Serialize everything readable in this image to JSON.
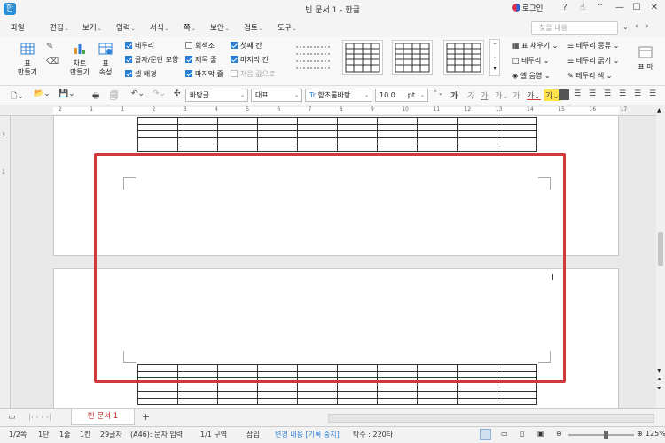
{
  "app": {
    "icon_letter": "한",
    "title": "빈 문서 1 - 한글",
    "login": "로그인"
  },
  "menu": [
    {
      "label": "파일",
      "dropdown": false
    },
    {
      "label": "편집",
      "dropdown": true
    },
    {
      "label": "보기",
      "dropdown": true
    },
    {
      "label": "입력",
      "dropdown": true
    },
    {
      "label": "서식",
      "dropdown": true
    },
    {
      "label": "쪽",
      "dropdown": true
    },
    {
      "label": "보안",
      "dropdown": true
    },
    {
      "label": "검토",
      "dropdown": true
    },
    {
      "label": "도구",
      "dropdown": true
    }
  ],
  "search": {
    "placeholder": "찾을 내용"
  },
  "ribbon": {
    "table_make": "표\n만들기",
    "chart_make": "차트\n만들기",
    "table_props": "표\n속성",
    "checks_col1": [
      {
        "label": "테두리",
        "checked": true
      },
      {
        "label": "글자/문단 모양",
        "checked": true
      },
      {
        "label": "셀 배경",
        "checked": true
      }
    ],
    "checks_col2": [
      {
        "label": "회색조",
        "checked": false
      },
      {
        "label": "제목 줄",
        "checked": true
      },
      {
        "label": "마지막 줄",
        "checked": true
      }
    ],
    "checks_col3": [
      {
        "label": "첫째 칸",
        "checked": true
      },
      {
        "label": "마지막 칸",
        "checked": true
      },
      {
        "label": "처음 값으로",
        "disabled": true
      }
    ],
    "right_col1": [
      "표 채우기",
      "테두리",
      "셀 음영"
    ],
    "right_col2": [
      "테두리 종류",
      "테두리 굵기",
      "테두리 색"
    ],
    "format_btn": "표 마"
  },
  "format": {
    "style": "바탕글",
    "lang": "대표",
    "font": "함초롬바탕",
    "size": "10.0",
    "unit": "pt"
  },
  "ruler_numbers": [
    "2",
    "1",
    "1",
    "2",
    "3",
    "4",
    "5",
    "6",
    "7",
    "8",
    "9",
    "10",
    "11",
    "12",
    "13",
    "14",
    "15",
    "16",
    "17"
  ],
  "doc": {
    "tab_name": "빈 문서 1",
    "table_cols": 10
  },
  "status": [
    "1/2쪽",
    "1단",
    "1줄",
    "1칸",
    "29글자",
    "(A46): 문자 입력",
    "1/1 구역",
    "삽입",
    "변경 내용 [기록 중지]",
    "탁수 : 220타"
  ],
  "zoom": "125%",
  "colors": {
    "accent": "#2a7fd4",
    "highlight": "#d0383c",
    "tab_text": "#c0282c"
  }
}
